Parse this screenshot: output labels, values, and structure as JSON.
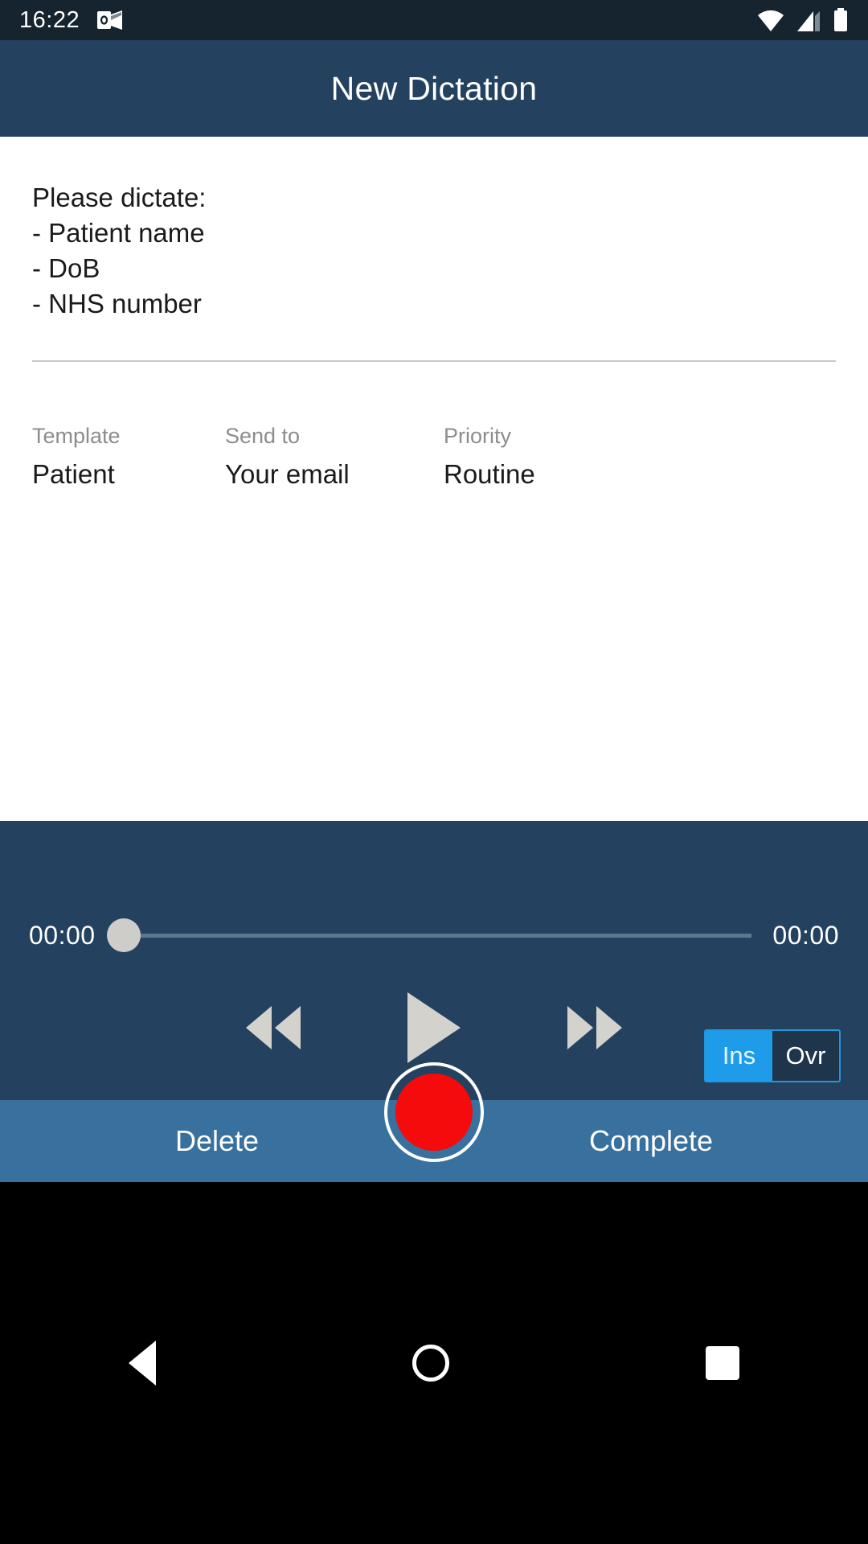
{
  "status_bar": {
    "time": "16:22",
    "notification_icon": "outlook-icon",
    "wifi_icon": "wifi-icon",
    "signal_icon": "cellular-signal-icon",
    "battery_icon": "battery-icon"
  },
  "app_bar": {
    "title": "New Dictation"
  },
  "content": {
    "instructions": [
      "Please dictate:",
      "- Patient name",
      "- DoB",
      "- NHS number"
    ],
    "meta": [
      {
        "label": "Template",
        "value": "Patient"
      },
      {
        "label": "Send to",
        "value": "Your email"
      },
      {
        "label": "Priority",
        "value": "Routine"
      }
    ]
  },
  "player": {
    "elapsed_time": "00:00",
    "total_time": "00:00",
    "seek_position_percent": 0,
    "rewind_icon": "rewind-icon",
    "play_icon": "play-icon",
    "forward_icon": "fast-forward-icon",
    "record_icon": "record-icon",
    "mode_toggle": {
      "options": [
        "Ins",
        "Ovr"
      ],
      "selected": "Ins",
      "selected_color": "#1e9be9",
      "border_color": "#2196dd"
    }
  },
  "actions": {
    "delete_label": "Delete",
    "complete_label": "Complete"
  },
  "navbar": {
    "back_icon": "back-triangle-icon",
    "home_icon": "home-circle-icon",
    "recents_icon": "recents-square-icon"
  },
  "colors": {
    "status_bar": "#16242f",
    "app_bar": "#244260",
    "player_panel": "#244260",
    "action_bar": "#38709e",
    "record_red": "#f50b0b",
    "accent_blue": "#1e9be9"
  }
}
